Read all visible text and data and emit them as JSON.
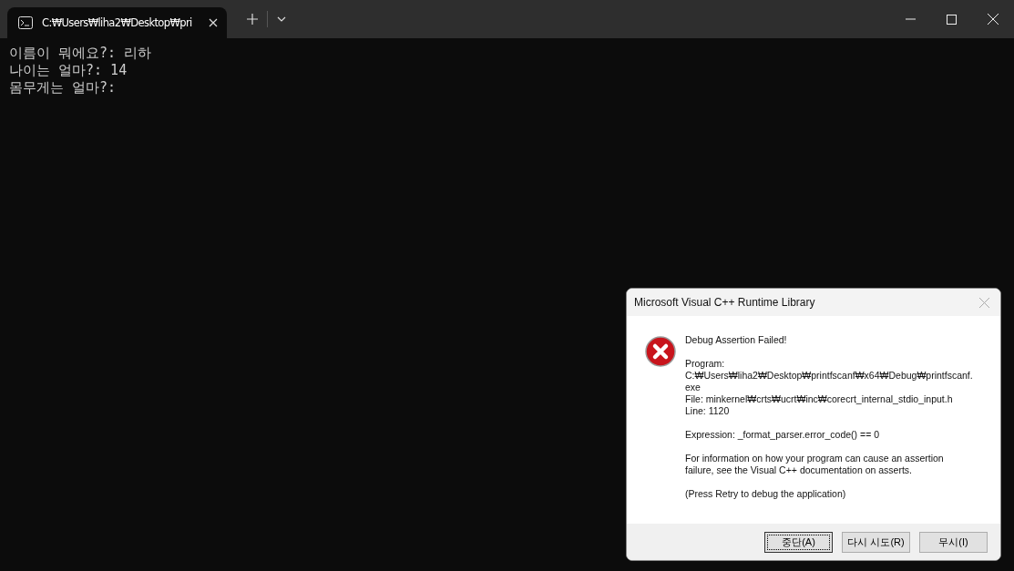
{
  "terminal": {
    "tab": {
      "title": "C:₩Users₩liha2₩Desktop₩pri",
      "selected": true
    },
    "lines": [
      "이름이 뭐에요?: 리하",
      "나이는 얼마?: 14",
      "몸무게는 얼마?:"
    ]
  },
  "dialog": {
    "title": "Microsoft Visual C++ Runtime Library",
    "paragraphs": [
      [
        "Debug Assertion Failed!"
      ],
      [
        "Program:",
        "C:₩Users₩liha2₩Desktop₩printfscanf₩x64₩Debug₩printfscanf.",
        "exe",
        "File: minkernel₩crts₩ucrt₩inc₩corecrt_internal_stdio_input.h",
        "Line: 1120"
      ],
      [
        "Expression: _format_parser.error_code() == 0"
      ],
      [
        "For information on how your program can cause an assertion",
        "failure, see the Visual C++ documentation on asserts."
      ],
      [
        "(Press Retry to debug the application)"
      ]
    ],
    "buttons": [
      {
        "label": "중단(A)",
        "selected": true
      },
      {
        "label": "다시 시도(R)",
        "selected": false
      },
      {
        "label": "무시(I)",
        "selected": false
      }
    ]
  }
}
